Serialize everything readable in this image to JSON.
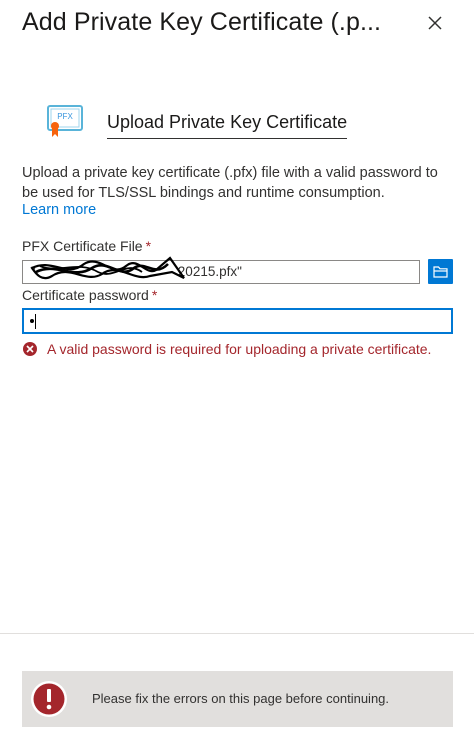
{
  "header": {
    "title": "Add Private Key Certificate (.p...",
    "close_icon": "close-icon"
  },
  "section": {
    "icon": "pfx-certificate-icon",
    "icon_text": "PFX",
    "heading": "Upload Private Key Certificate",
    "description": "Upload a private key certificate (.pfx) file with a valid password to be used for TLS/SSL bindings and runtime consumption.",
    "learn_more": "Learn more"
  },
  "form": {
    "pfx_label": "PFX Certificate File",
    "pfx_value": "\"...20215.pfx\"",
    "pfx_visible_tail": "20215.pfx\"",
    "pfx_prefix": "\"",
    "required_mark": "*",
    "browse_icon": "folder-icon",
    "password_label": "Certificate password",
    "error_icon": "error-circle-icon",
    "error_message": "A valid password is required for uploading a private certificate."
  },
  "footer": {
    "banner_icon": "error-exclamation-icon",
    "banner_message": "Please fix the errors on this page before continuing."
  },
  "colors": {
    "accent": "#0078d4",
    "error": "#a4262c",
    "banner_bg": "#e1dfdd",
    "banner_icon": "#a4262c",
    "cert_badge": "#f7630c"
  }
}
